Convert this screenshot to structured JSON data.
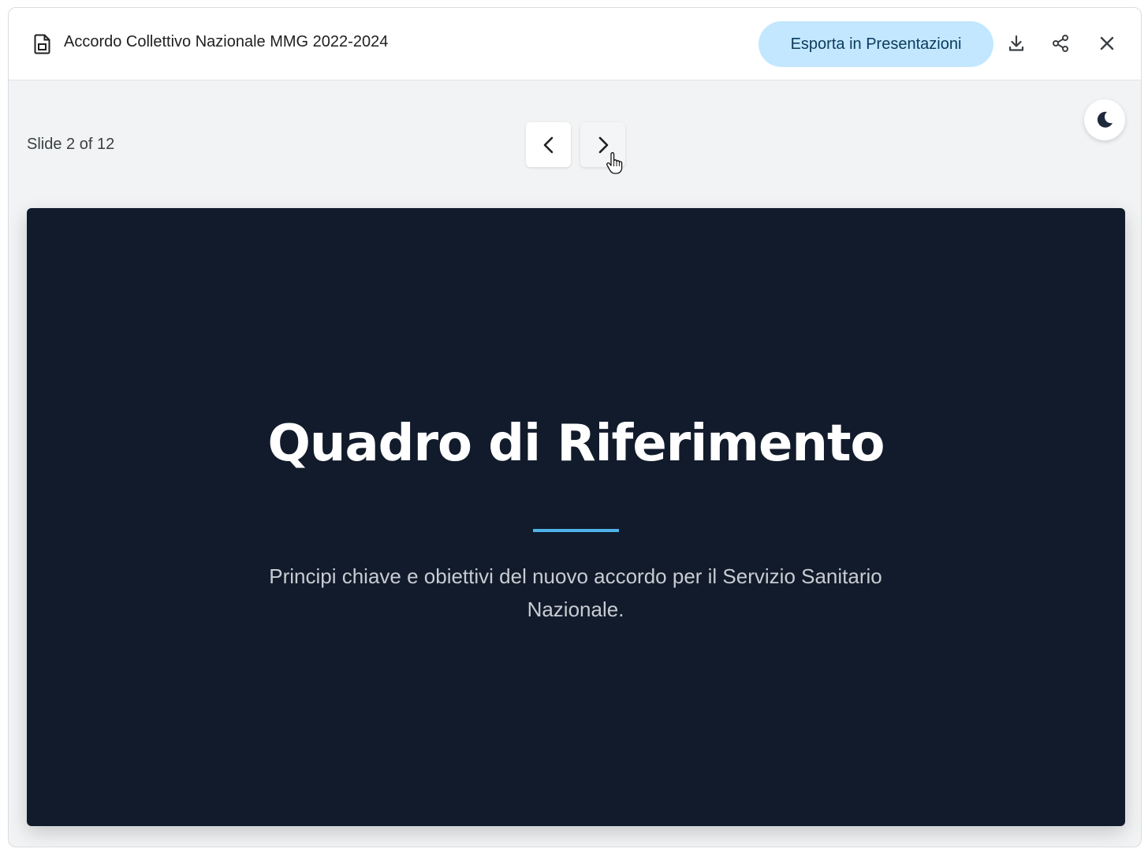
{
  "header": {
    "title": "Accordo Collettivo Nazionale MMG 2022-2024",
    "export_label": "Esporta in Presentazioni",
    "icons": [
      "document-icon",
      "download-icon",
      "share-icon",
      "close-icon"
    ]
  },
  "toolbar": {
    "slide_counter": "Slide 2 of 12",
    "prev_icon": "chevron-left-icon",
    "next_icon": "chevron-right-icon",
    "theme_icon": "moon-icon"
  },
  "slide": {
    "title": "Quadro di Riferimento",
    "subtitle": "Principi chiave e obiettivi del nuovo accordo per il Servizio Sanitario Nazionale."
  },
  "colors": {
    "slide_background": "#111b2b",
    "accent": "#4fb3e8",
    "export_button": "#c2e7ff"
  }
}
